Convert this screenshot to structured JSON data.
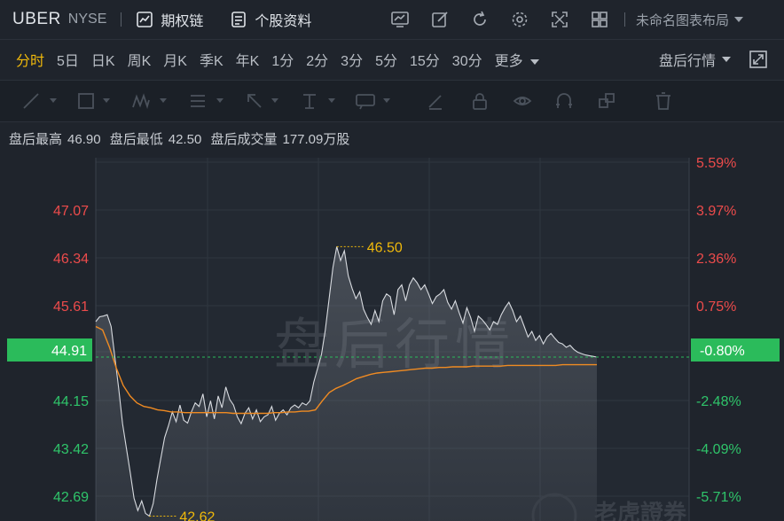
{
  "header": {
    "ticker": "UBER",
    "exchange": "NYSE",
    "options_chain": "期权链",
    "stock_profile": "个股资料",
    "layout_menu": "未命名图表布局"
  },
  "icons": [
    "chart-trend-icon",
    "edit-icon",
    "refresh-icon",
    "settings-icon",
    "fullscreen-icon",
    "grid-layout-icon"
  ],
  "timeframes": [
    "分时",
    "5日",
    "日K",
    "周K",
    "月K",
    "季K",
    "年K",
    "1分",
    "2分",
    "3分",
    "5分",
    "15分",
    "30分",
    "更多"
  ],
  "active_timeframe": "分时",
  "session_menu": "盘后行情",
  "info": {
    "high_label": "盘后最高",
    "high_value": "46.90",
    "low_label": "盘后最低",
    "low_value": "42.50",
    "volume_label": "盘后成交量",
    "volume_value": "177.09万股"
  },
  "watermark": "盘后行情",
  "logo_text": "老虎證券",
  "colors": {
    "up": "#ec4b4b",
    "down": "#2fc46a",
    "avg_line": "#f08b22",
    "price_line": "#d8dbe0",
    "highlight": "#f0b90b",
    "current": "#2bbb5b"
  },
  "chart_data": {
    "type": "line",
    "title": "",
    "y_labels_left": [
      "47.07",
      "46.34",
      "45.61",
      "44.91",
      "44.15",
      "43.42",
      "42.69"
    ],
    "y_labels_right": [
      "5.59%",
      "3.97%",
      "2.36%",
      "0.75%",
      "-0.80%",
      "-2.48%",
      "-4.09%",
      "-5.71%"
    ],
    "ylim": [
      42.55,
      47.78
    ],
    "current_price": "44.91",
    "current_pct": "-0.80%",
    "max_marker": "46.50",
    "min_marker": "42.62",
    "series": [
      {
        "values": [
          45.42,
          45.49,
          45.5,
          45.52,
          45.35,
          44.9,
          44.45,
          43.95,
          43.6,
          43.25,
          42.88,
          42.7,
          42.84,
          42.66,
          42.62,
          42.8,
          43.15,
          43.45,
          43.75,
          43.92,
          44.12,
          43.98,
          44.22,
          44.0,
          43.96,
          44.12,
          44.25,
          44.2,
          44.38,
          44.05,
          44.28,
          44.02,
          44.35,
          44.18,
          44.48,
          44.3,
          44.22,
          44.05,
          43.95,
          44.1,
          44.18,
          44.02,
          44.15,
          43.98,
          44.05,
          44.08,
          44.2,
          44.0,
          44.1,
          44.15,
          44.08,
          44.18,
          44.22,
          44.18,
          44.25,
          44.22,
          44.28,
          44.55,
          44.75,
          44.95,
          45.3,
          45.75,
          46.2,
          46.5,
          46.3,
          46.44,
          46.08,
          45.9,
          45.75,
          45.85,
          45.6,
          45.48,
          45.38,
          45.58,
          45.42,
          45.72,
          45.82,
          45.78,
          45.52,
          45.88,
          45.95,
          45.72,
          45.95,
          46.05,
          45.98,
          45.88,
          45.95,
          45.82,
          45.68,
          45.78,
          45.82,
          45.88,
          45.7,
          45.6,
          45.72,
          45.55,
          45.4,
          45.62,
          45.48,
          45.28,
          45.5,
          45.45,
          45.38,
          45.3,
          45.42,
          45.38,
          45.52,
          45.62,
          45.7,
          45.58,
          45.42,
          45.5,
          45.35,
          45.2,
          45.28,
          45.15,
          45.22,
          45.1,
          45.2,
          45.25,
          45.18,
          45.12,
          45.1,
          45.05,
          45.08,
          45.02,
          44.98,
          44.96,
          44.94,
          44.93,
          44.92,
          44.91
        ]
      },
      {
        "values": [
          45.35,
          45.3,
          45.05,
          44.75,
          44.5,
          44.35,
          44.25,
          44.2,
          44.18,
          44.15,
          44.14,
          44.12,
          44.12,
          44.11,
          44.11,
          44.11,
          44.11,
          44.11,
          44.11,
          44.11,
          44.1,
          44.1,
          44.1,
          44.1,
          44.1,
          44.1,
          44.11,
          44.11,
          44.12,
          44.12,
          44.13,
          44.13,
          44.15,
          44.28,
          44.4,
          44.46,
          44.5,
          44.55,
          44.6,
          44.63,
          44.66,
          44.68,
          44.69,
          44.7,
          44.71,
          44.72,
          44.73,
          44.74,
          44.75,
          44.75,
          44.76,
          44.76,
          44.77,
          44.77,
          44.77,
          44.78,
          44.78,
          44.78,
          44.78,
          44.78,
          44.79,
          44.79,
          44.79,
          44.79,
          44.79,
          44.79,
          44.79,
          44.79,
          44.8,
          44.8,
          44.8,
          44.8,
          44.8,
          44.8
        ]
      }
    ]
  }
}
